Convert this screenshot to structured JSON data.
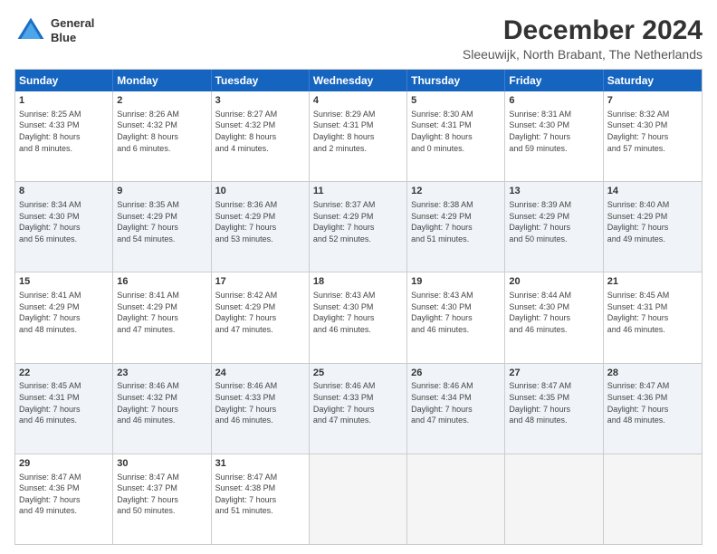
{
  "logo": {
    "line1": "General",
    "line2": "Blue"
  },
  "title": "December 2024",
  "subtitle": "Sleeuwijk, North Brabant, The Netherlands",
  "days": [
    "Sunday",
    "Monday",
    "Tuesday",
    "Wednesday",
    "Thursday",
    "Friday",
    "Saturday"
  ],
  "rows": [
    [
      {
        "day": "1",
        "info": "Sunrise: 8:25 AM\nSunset: 4:33 PM\nDaylight: 8 hours\nand 8 minutes."
      },
      {
        "day": "2",
        "info": "Sunrise: 8:26 AM\nSunset: 4:32 PM\nDaylight: 8 hours\nand 6 minutes."
      },
      {
        "day": "3",
        "info": "Sunrise: 8:27 AM\nSunset: 4:32 PM\nDaylight: 8 hours\nand 4 minutes."
      },
      {
        "day": "4",
        "info": "Sunrise: 8:29 AM\nSunset: 4:31 PM\nDaylight: 8 hours\nand 2 minutes."
      },
      {
        "day": "5",
        "info": "Sunrise: 8:30 AM\nSunset: 4:31 PM\nDaylight: 8 hours\nand 0 minutes."
      },
      {
        "day": "6",
        "info": "Sunrise: 8:31 AM\nSunset: 4:30 PM\nDaylight: 7 hours\nand 59 minutes."
      },
      {
        "day": "7",
        "info": "Sunrise: 8:32 AM\nSunset: 4:30 PM\nDaylight: 7 hours\nand 57 minutes."
      }
    ],
    [
      {
        "day": "8",
        "info": "Sunrise: 8:34 AM\nSunset: 4:30 PM\nDaylight: 7 hours\nand 56 minutes."
      },
      {
        "day": "9",
        "info": "Sunrise: 8:35 AM\nSunset: 4:29 PM\nDaylight: 7 hours\nand 54 minutes."
      },
      {
        "day": "10",
        "info": "Sunrise: 8:36 AM\nSunset: 4:29 PM\nDaylight: 7 hours\nand 53 minutes."
      },
      {
        "day": "11",
        "info": "Sunrise: 8:37 AM\nSunset: 4:29 PM\nDaylight: 7 hours\nand 52 minutes."
      },
      {
        "day": "12",
        "info": "Sunrise: 8:38 AM\nSunset: 4:29 PM\nDaylight: 7 hours\nand 51 minutes."
      },
      {
        "day": "13",
        "info": "Sunrise: 8:39 AM\nSunset: 4:29 PM\nDaylight: 7 hours\nand 50 minutes."
      },
      {
        "day": "14",
        "info": "Sunrise: 8:40 AM\nSunset: 4:29 PM\nDaylight: 7 hours\nand 49 minutes."
      }
    ],
    [
      {
        "day": "15",
        "info": "Sunrise: 8:41 AM\nSunset: 4:29 PM\nDaylight: 7 hours\nand 48 minutes."
      },
      {
        "day": "16",
        "info": "Sunrise: 8:41 AM\nSunset: 4:29 PM\nDaylight: 7 hours\nand 47 minutes."
      },
      {
        "day": "17",
        "info": "Sunrise: 8:42 AM\nSunset: 4:29 PM\nDaylight: 7 hours\nand 47 minutes."
      },
      {
        "day": "18",
        "info": "Sunrise: 8:43 AM\nSunset: 4:30 PM\nDaylight: 7 hours\nand 46 minutes."
      },
      {
        "day": "19",
        "info": "Sunrise: 8:43 AM\nSunset: 4:30 PM\nDaylight: 7 hours\nand 46 minutes."
      },
      {
        "day": "20",
        "info": "Sunrise: 8:44 AM\nSunset: 4:30 PM\nDaylight: 7 hours\nand 46 minutes."
      },
      {
        "day": "21",
        "info": "Sunrise: 8:45 AM\nSunset: 4:31 PM\nDaylight: 7 hours\nand 46 minutes."
      }
    ],
    [
      {
        "day": "22",
        "info": "Sunrise: 8:45 AM\nSunset: 4:31 PM\nDaylight: 7 hours\nand 46 minutes."
      },
      {
        "day": "23",
        "info": "Sunrise: 8:46 AM\nSunset: 4:32 PM\nDaylight: 7 hours\nand 46 minutes."
      },
      {
        "day": "24",
        "info": "Sunrise: 8:46 AM\nSunset: 4:33 PM\nDaylight: 7 hours\nand 46 minutes."
      },
      {
        "day": "25",
        "info": "Sunrise: 8:46 AM\nSunset: 4:33 PM\nDaylight: 7 hours\nand 47 minutes."
      },
      {
        "day": "26",
        "info": "Sunrise: 8:46 AM\nSunset: 4:34 PM\nDaylight: 7 hours\nand 47 minutes."
      },
      {
        "day": "27",
        "info": "Sunrise: 8:47 AM\nSunset: 4:35 PM\nDaylight: 7 hours\nand 48 minutes."
      },
      {
        "day": "28",
        "info": "Sunrise: 8:47 AM\nSunset: 4:36 PM\nDaylight: 7 hours\nand 48 minutes."
      }
    ],
    [
      {
        "day": "29",
        "info": "Sunrise: 8:47 AM\nSunset: 4:36 PM\nDaylight: 7 hours\nand 49 minutes."
      },
      {
        "day": "30",
        "info": "Sunrise: 8:47 AM\nSunset: 4:37 PM\nDaylight: 7 hours\nand 50 minutes."
      },
      {
        "day": "31",
        "info": "Sunrise: 8:47 AM\nSunset: 4:38 PM\nDaylight: 7 hours\nand 51 minutes."
      },
      {
        "day": "",
        "info": ""
      },
      {
        "day": "",
        "info": ""
      },
      {
        "day": "",
        "info": ""
      },
      {
        "day": "",
        "info": ""
      }
    ]
  ]
}
